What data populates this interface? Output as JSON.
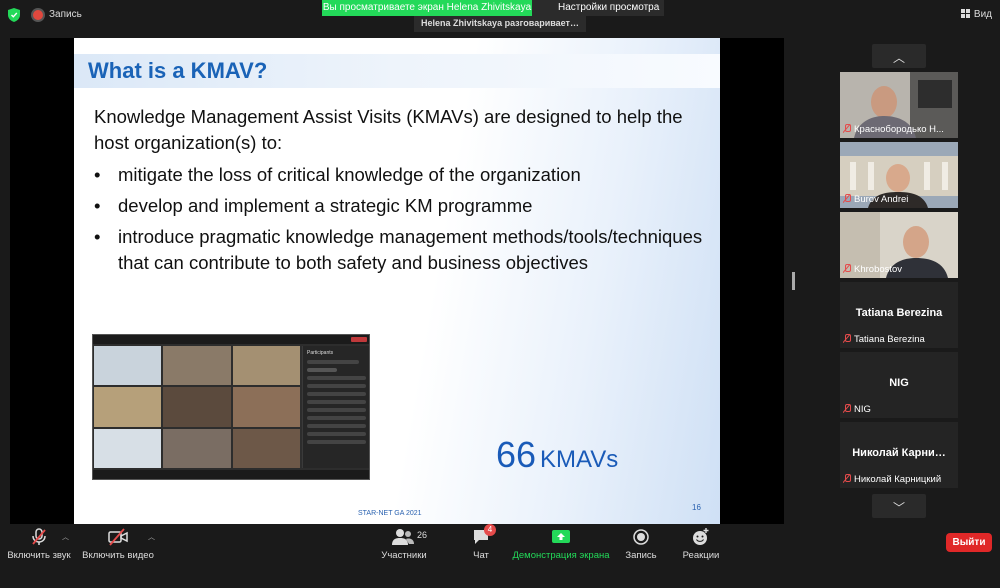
{
  "topbar": {
    "record_label": "Запись",
    "share_banner": "Вы просматриваете экран Helena Zhivitskaya",
    "view_options": "Настройки просмотра",
    "speaking": "Helena Zhivitskaya разговаривает…",
    "view_label": "Вид",
    "icons": [
      "shield-icon",
      "record-icon",
      "chevron-down-icon",
      "grid-view-icon"
    ]
  },
  "slide": {
    "title": "What is a KMAV?",
    "intro": "Knowledge Management Assist Visits (KMAVs) are designed to help the host organization(s) to:",
    "bullets": [
      "mitigate the loss of critical knowledge of the organization",
      "develop and implement a strategic KM programme",
      "introduce pragmatic knowledge management methods/tools/techniques that can contribute to both safety and business objectives"
    ],
    "kmav_number": "66",
    "kmav_unit": "KMAVs",
    "footer": "STAR-NET GA 2021",
    "page_number": "16",
    "embedded_screenshot": {
      "participants_heading": "Participants"
    },
    "colors": {
      "title": "#1a63b7",
      "kmav": "#1a5bb8"
    }
  },
  "gallery": {
    "participants": [
      {
        "name": "Краснобородько Н...",
        "type": "video",
        "muted": true
      },
      {
        "name": "Burov Andrei",
        "type": "video",
        "muted": true
      },
      {
        "name": "Khrobostov",
        "type": "video",
        "muted": true
      },
      {
        "display": "Tatiana Berezina",
        "name": "Tatiana Berezina",
        "type": "name",
        "muted": true
      },
      {
        "display": "NIG",
        "name": "NIG",
        "type": "name",
        "muted": true
      },
      {
        "display": "Николай  Карни…",
        "name": "Николай Карницкий",
        "type": "name",
        "muted": true
      }
    ],
    "icons": [
      "chevron-up-icon",
      "chevron-down-icon",
      "mic-off-icon"
    ]
  },
  "toolbar": {
    "unmute": "Включить звук",
    "start_video": "Включить видео",
    "participants": "Участники",
    "participants_count": "26",
    "chat": "Чат",
    "chat_badge": "4",
    "share_screen": "Демонстрация экрана",
    "record": "Запись",
    "reactions": "Реакции",
    "leave": "Выйти",
    "colors": {
      "share": "#23d959",
      "leave": "#e02828",
      "badge": "#e54b4b"
    }
  }
}
